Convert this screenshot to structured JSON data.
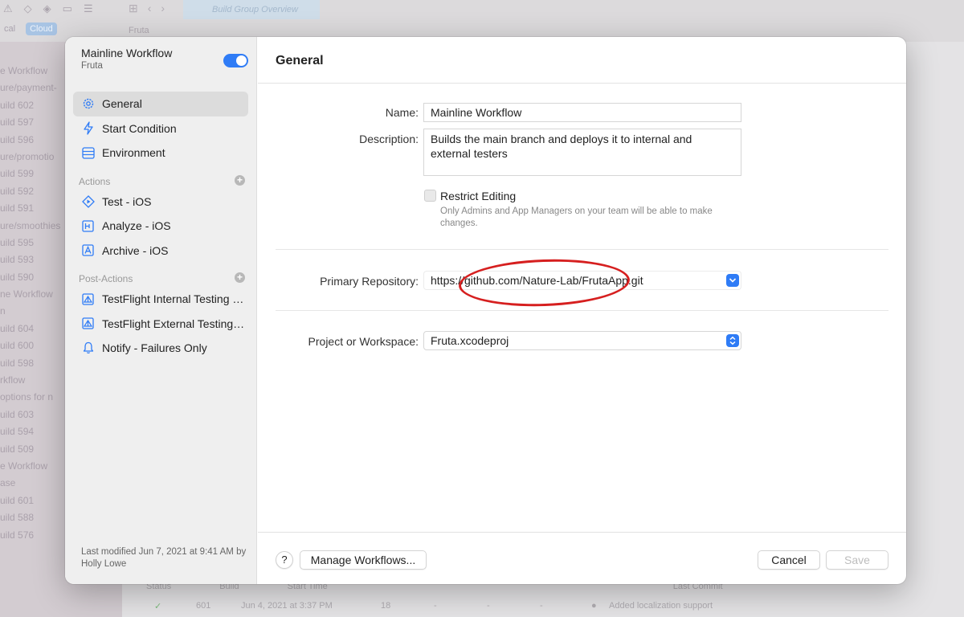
{
  "background": {
    "segmented": [
      "cal",
      "Cloud"
    ],
    "tab_title": "Build Group Overview",
    "breadcrumb": "Fruta",
    "sidebar_list": [
      "e Workflow",
      "ure/payment-",
      "uild 602",
      "uild 597",
      "uild 596",
      "ure/promotio",
      "uild 599",
      "uild 592",
      "uild 591",
      "ure/smoothies",
      "uild 595",
      "uild 593",
      "uild 590",
      "ne Workflow",
      "n",
      "uild 604",
      "uild 600",
      "uild 598",
      "rkflow",
      "options for n",
      "uild 603",
      "uild 594",
      "uild 509",
      "e Workflow",
      "ase",
      "uild 601",
      "uild 588",
      "uild 576"
    ],
    "table_headers": [
      "Status",
      "Build",
      "Start Time",
      "Last Commit"
    ],
    "row": {
      "build": "601",
      "time": "Jun 4, 2021 at 3:37 PM",
      "count": "18",
      "dash1": "-",
      "dash2": "-",
      "dash3": "-",
      "commit": "Added localization support"
    }
  },
  "workflow": {
    "title": "Mainline Workflow",
    "subtitle": "Fruta",
    "enabled": true
  },
  "nav": {
    "general": "General",
    "start_condition": "Start Condition",
    "environment": "Environment",
    "actions_header": "Actions",
    "test": "Test - iOS",
    "analyze": "Analyze - iOS",
    "archive": "Archive - iOS",
    "post_actions_header": "Post-Actions",
    "tf_internal": "TestFlight Internal Testing - iOS",
    "tf_external": "TestFlight External Testing - iOS",
    "notify": "Notify - Failures Only"
  },
  "last_modified": "Last modified Jun 7, 2021 at 9:41 AM by Holly Lowe",
  "content": {
    "title": "General",
    "name_label": "Name:",
    "name_value": "Mainline Workflow",
    "description_label": "Description:",
    "description_value": "Builds the main branch and deploys it to internal and external testers",
    "restrict_label": "Restrict Editing",
    "restrict_help": "Only Admins and App Managers on your team will be able to make changes.",
    "repo_label": "Primary Repository:",
    "repo_value": "https://github.com/Nature-Lab/FrutaApp.git",
    "project_label": "Project or Workspace:",
    "project_value": "Fruta.xcodeproj"
  },
  "footer": {
    "help": "?",
    "manage": "Manage Workflows...",
    "cancel": "Cancel",
    "save": "Save"
  },
  "colors": {
    "accent": "#2f7cf6",
    "annotation": "#d61f1f"
  },
  "icons": {
    "general": "gear-icon",
    "start_condition": "bolt-icon",
    "environment": "server-icon",
    "test": "play-icon",
    "analyze": "analyze-icon",
    "archive": "archive-icon",
    "testflight": "testflight-icon",
    "notify": "bell-icon"
  }
}
